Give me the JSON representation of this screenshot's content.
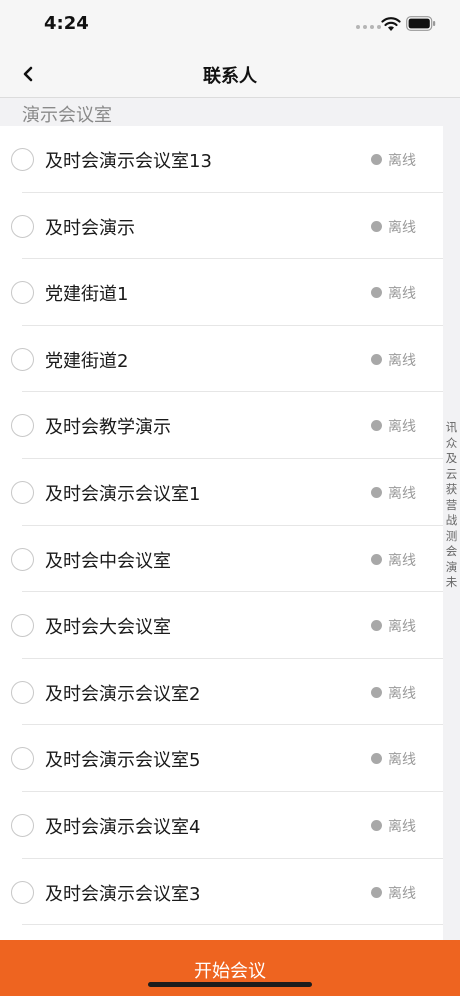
{
  "status_bar": {
    "time": "4:24",
    "wifi_icon": "wifi-icon",
    "battery_icon": "battery-icon"
  },
  "nav": {
    "title": "联系人",
    "back_icon": "chevron-left-icon"
  },
  "section": {
    "header": "演示会议室"
  },
  "contacts": [
    {
      "name": "及时会演示会议室13",
      "status": "离线"
    },
    {
      "name": "及时会演示",
      "status": "离线"
    },
    {
      "name": "党建街道1",
      "status": "离线"
    },
    {
      "name": "党建街道2",
      "status": "离线"
    },
    {
      "name": "及时会教学演示",
      "status": "离线"
    },
    {
      "name": "及时会演示会议室1",
      "status": "离线"
    },
    {
      "name": "及时会中会议室",
      "status": "离线"
    },
    {
      "name": "及时会大会议室",
      "status": "离线"
    },
    {
      "name": "及时会演示会议室2",
      "status": "离线"
    },
    {
      "name": "及时会演示会议室5",
      "status": "离线"
    },
    {
      "name": "及时会演示会议室4",
      "status": "离线"
    },
    {
      "name": "及时会演示会议室3",
      "status": "离线"
    }
  ],
  "index_bar": [
    "讯",
    "众",
    "及",
    "云",
    "获",
    "营",
    "战",
    "测",
    "会",
    "演",
    "未"
  ],
  "footer": {
    "start_label": "开始会议"
  },
  "colors": {
    "accent": "#ee6420",
    "offline_dot": "#a8a8a8",
    "background": "#f2f2f4"
  }
}
